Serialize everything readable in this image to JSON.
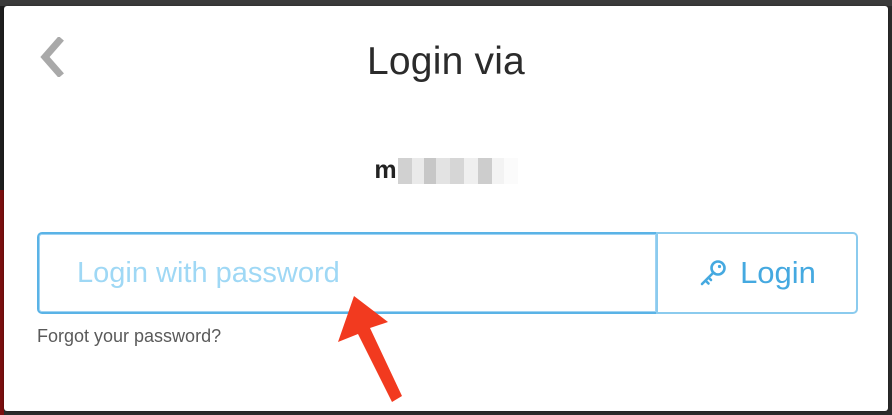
{
  "dialog": {
    "title": "Login via",
    "account_name_visible": "m",
    "back_icon": "chevron-left-icon"
  },
  "login_form": {
    "password_placeholder": "Login with password",
    "password_value": "",
    "login_button_label": "Login",
    "login_button_icon": "key-icon",
    "forgot_password_link": "Forgot your password?"
  },
  "annotation": {
    "arrow_icon": "red-arrow-pointer",
    "arrow_color": "#f23a1f"
  },
  "colors": {
    "accent": "#45a9e0",
    "input_border": "#5ab3e6",
    "placeholder": "#9fd8f5",
    "title_text": "#2b2b2b"
  }
}
